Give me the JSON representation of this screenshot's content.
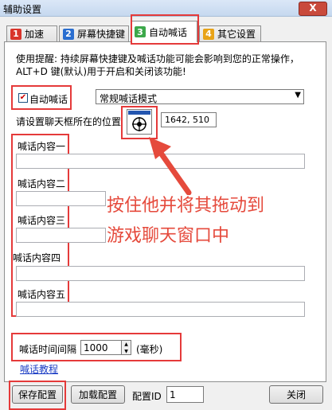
{
  "window": {
    "title": "辅助设置",
    "close_label": "X"
  },
  "tabs": [
    {
      "num": "1",
      "label": "加速",
      "color": "#d9342b"
    },
    {
      "num": "2",
      "label": "屏幕快捷键",
      "color": "#2a6ed0"
    },
    {
      "num": "3",
      "label": "自动喊话",
      "color": "#3ca84a"
    },
    {
      "num": "4",
      "label": "其它设置",
      "color": "#e8a317"
    }
  ],
  "tip": "使用提醒: 持续屏幕快捷键及喊话功能可能会影响到您的正常操作，ALT+D 键(默认)用于开启和关闭该功能!",
  "auto_shout": {
    "checkbox_label": "自动喊话",
    "checked": true,
    "mode_value": "常规喊话模式"
  },
  "chat_position": {
    "label": "请设置聊天框所在的位置",
    "value": "1642, 510"
  },
  "shout_contents": [
    {
      "label": "喊话内容一",
      "value": ""
    },
    {
      "label": "喊话内容二",
      "value": ""
    },
    {
      "label": "喊话内容三",
      "value": ""
    },
    {
      "label": "喊话内容四",
      "value": ""
    },
    {
      "label": "喊话内容五",
      "value": ""
    }
  ],
  "annotation": {
    "line1": "按住他并将其拖动到",
    "line2": "游戏聊天窗口中"
  },
  "interval": {
    "label": "喊话时间间隔",
    "value": "1000",
    "unit": "(毫秒)"
  },
  "tutorial_link": "喊话教程",
  "footer": {
    "save_label": "保存配置",
    "load_label": "加载配置",
    "config_id_label": "配置ID",
    "config_id_value": "1",
    "close_label": "关闭"
  },
  "colors": {
    "highlight": "#e53a3a",
    "annotation": "#e54a3c",
    "link": "#1a3cc4"
  }
}
